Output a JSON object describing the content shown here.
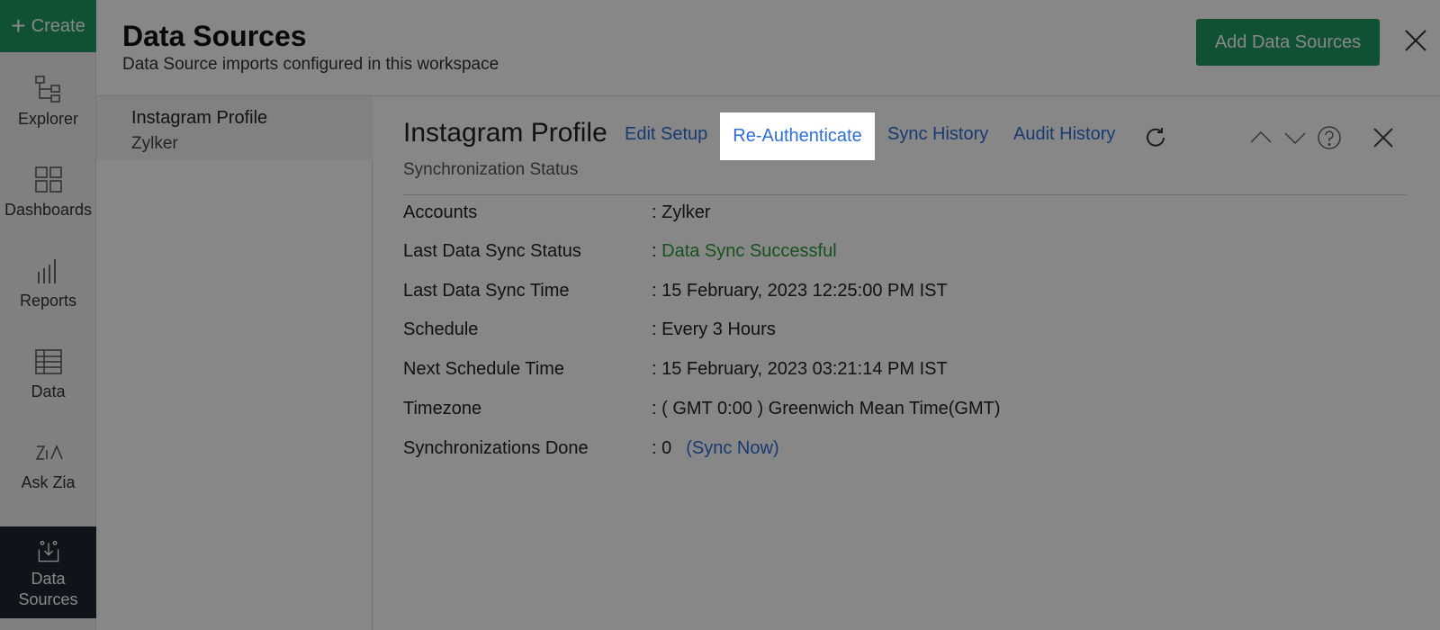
{
  "nav": {
    "create_label": "Create",
    "items": [
      {
        "label": "Explorer",
        "icon": "explorer-icon"
      },
      {
        "label": "Dashboards",
        "icon": "dashboards-icon"
      },
      {
        "label": "Reports",
        "icon": "reports-icon"
      },
      {
        "label": "Data",
        "icon": "data-icon"
      },
      {
        "label": "Ask Zia",
        "icon": "zia-icon"
      }
    ],
    "active": {
      "line1": "Data",
      "line2": "Sources",
      "icon": "data-sources-icon"
    }
  },
  "header": {
    "title": "Data Sources",
    "subtitle": "Data Source imports configured in this workspace",
    "add_button": "Add Data Sources"
  },
  "list": {
    "name": "Instagram Profile",
    "sub": "Zylker"
  },
  "detail": {
    "title": "Instagram Profile",
    "links": {
      "edit_setup": "Edit Setup",
      "reauth": "Re-Authenticate",
      "sync_history": "Sync History",
      "audit_history": "Audit History"
    },
    "status_label": "Synchronization Status",
    "rows": [
      {
        "label": "Accounts",
        "value": ": Zylker"
      },
      {
        "label": "Last Data Sync Status",
        "value_prefix": ": ",
        "value": "Data Sync Successful"
      },
      {
        "label": "Last Data Sync Time",
        "value": ": 15 February, 2023 12:25:00 PM IST"
      },
      {
        "label": "Schedule",
        "value": ": Every 3 Hours"
      },
      {
        "label": "Next Schedule Time",
        "value": ": 15 February, 2023 03:21:14 PM IST"
      },
      {
        "label": "Timezone",
        "value": ": ( GMT 0:00 ) Greenwich Mean Time(GMT)"
      },
      {
        "label": "Synchronizations Done",
        "value": ": 0",
        "action": "(Sync Now)"
      }
    ]
  },
  "colors": {
    "accent": "#1f9a61",
    "link": "#2f6ed6",
    "success": "#2e9a36",
    "nav_active": "#1d2733"
  }
}
